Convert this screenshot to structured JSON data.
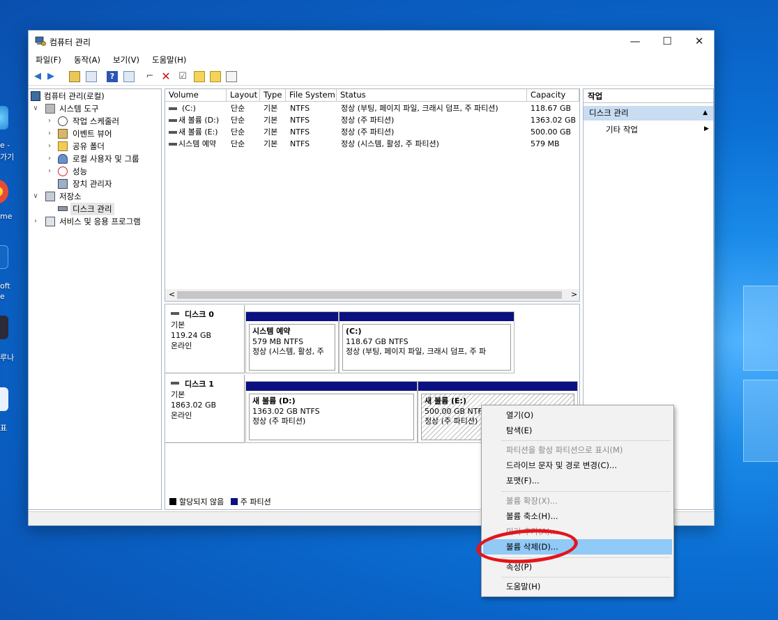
{
  "desktop": {
    "icon_labels": [
      "e -",
      "가기",
      "me",
      "oft",
      "e",
      "루나",
      "표"
    ]
  },
  "window": {
    "title": "컴퓨터 관리",
    "controls": {
      "minimize": "—",
      "maximize": "☐",
      "close": "✕"
    }
  },
  "menu": [
    "파일(F)",
    "동작(A)",
    "보기(V)",
    "도움말(H)"
  ],
  "tree": {
    "root": "컴퓨터 관리(로컬)",
    "system_tools": "시스템 도구",
    "items": [
      "작업 스케줄러",
      "이벤트 뷰어",
      "공유 폴더",
      "로컬 사용자 및 그룹",
      "성능",
      "장치 관리자"
    ],
    "storage": "저장소",
    "disk_mgmt": "디스크 관리",
    "services": "서비스 및 응용 프로그램"
  },
  "volumes": {
    "headers": [
      "Volume",
      "Layout",
      "Type",
      "File System",
      "Status",
      "Capacity"
    ],
    "rows": [
      {
        "volume": "(C:)",
        "layout": "단순",
        "type": "기본",
        "fs": "NTFS",
        "status": "정상 (부팅, 페이지 파일, 크래시 덤프, 주 파티션)",
        "capacity": "118.67 GB"
      },
      {
        "volume": "새 볼륨 (D:)",
        "layout": "단순",
        "type": "기본",
        "fs": "NTFS",
        "status": "정상 (주 파티션)",
        "capacity": "1363.02 GB"
      },
      {
        "volume": "새 볼륨 (E:)",
        "layout": "단순",
        "type": "기본",
        "fs": "NTFS",
        "status": "정상 (주 파티션)",
        "capacity": "500.00 GB"
      },
      {
        "volume": "시스템 예약",
        "layout": "단순",
        "type": "기본",
        "fs": "NTFS",
        "status": "정상 (시스템, 활성, 주 파티션)",
        "capacity": "579 MB"
      }
    ],
    "scroll_left": "<",
    "scroll_right": ">"
  },
  "disks": [
    {
      "name": "디스크 0",
      "type": "기본",
      "size": "119.24 GB",
      "state": "온라인",
      "partitions": [
        {
          "name": "시스템 예약",
          "size": "579 MB NTFS",
          "status": "정상 (시스템, 활성, 주"
        },
        {
          "name": "(C:)",
          "size": "118.67 GB NTFS",
          "status": "정상 (부팅, 페이지 파일, 크래시 덤프, 주 파"
        }
      ]
    },
    {
      "name": "디스크 1",
      "type": "기본",
      "size": "1863.02 GB",
      "state": "온라인",
      "partitions": [
        {
          "name": "새 볼륨  (D:)",
          "size": "1363.02 GB NTFS",
          "status": "정상 (주 파티션)"
        },
        {
          "name": "새 볼륨  (E:)",
          "size": "500.00 GB NTFS",
          "status": "정상 (주 파티션)"
        }
      ]
    }
  ],
  "legend": {
    "unallocated": "할당되지 않음",
    "primary": "주 파티션"
  },
  "actions": {
    "header": "작업",
    "section": "디스크 관리",
    "more": "기타 작업",
    "collapse_glyph": "▲",
    "more_glyph": "▶"
  },
  "context_menu": {
    "items": [
      "열기(O)",
      "탐색(E)",
      "파티션을 활성 파티션으로 표시(M)",
      "드라이브 문자 및 경로 변경(C)...",
      "포맷(F)...",
      "볼륨 확장(X)...",
      "볼륨 축소(H)...",
      "미러 추가(A)...",
      "볼륨 삭제(D)...",
      "속성(P)",
      "도움말(H)"
    ],
    "highlighted": "볼륨 삭제(D)..."
  },
  "colors": {
    "primary_partition": "#0b1180",
    "highlight": "#91c9f7",
    "annotation_ring": "#e3151a"
  }
}
